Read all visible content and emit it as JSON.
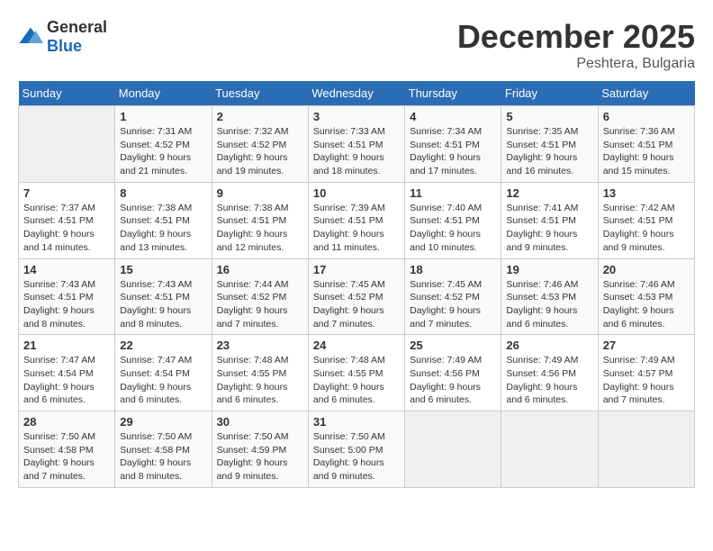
{
  "logo": {
    "general": "General",
    "blue": "Blue"
  },
  "title": "December 2025",
  "location": "Peshtera, Bulgaria",
  "days_of_week": [
    "Sunday",
    "Monday",
    "Tuesday",
    "Wednesday",
    "Thursday",
    "Friday",
    "Saturday"
  ],
  "weeks": [
    [
      {
        "day": "",
        "sunrise": "",
        "sunset": "",
        "daylight": "",
        "empty": true
      },
      {
        "day": "1",
        "sunrise": "Sunrise: 7:31 AM",
        "sunset": "Sunset: 4:52 PM",
        "daylight": "Daylight: 9 hours and 21 minutes."
      },
      {
        "day": "2",
        "sunrise": "Sunrise: 7:32 AM",
        "sunset": "Sunset: 4:52 PM",
        "daylight": "Daylight: 9 hours and 19 minutes."
      },
      {
        "day": "3",
        "sunrise": "Sunrise: 7:33 AM",
        "sunset": "Sunset: 4:51 PM",
        "daylight": "Daylight: 9 hours and 18 minutes."
      },
      {
        "day": "4",
        "sunrise": "Sunrise: 7:34 AM",
        "sunset": "Sunset: 4:51 PM",
        "daylight": "Daylight: 9 hours and 17 minutes."
      },
      {
        "day": "5",
        "sunrise": "Sunrise: 7:35 AM",
        "sunset": "Sunset: 4:51 PM",
        "daylight": "Daylight: 9 hours and 16 minutes."
      },
      {
        "day": "6",
        "sunrise": "Sunrise: 7:36 AM",
        "sunset": "Sunset: 4:51 PM",
        "daylight": "Daylight: 9 hours and 15 minutes."
      }
    ],
    [
      {
        "day": "7",
        "sunrise": "Sunrise: 7:37 AM",
        "sunset": "Sunset: 4:51 PM",
        "daylight": "Daylight: 9 hours and 14 minutes."
      },
      {
        "day": "8",
        "sunrise": "Sunrise: 7:38 AM",
        "sunset": "Sunset: 4:51 PM",
        "daylight": "Daylight: 9 hours and 13 minutes."
      },
      {
        "day": "9",
        "sunrise": "Sunrise: 7:38 AM",
        "sunset": "Sunset: 4:51 PM",
        "daylight": "Daylight: 9 hours and 12 minutes."
      },
      {
        "day": "10",
        "sunrise": "Sunrise: 7:39 AM",
        "sunset": "Sunset: 4:51 PM",
        "daylight": "Daylight: 9 hours and 11 minutes."
      },
      {
        "day": "11",
        "sunrise": "Sunrise: 7:40 AM",
        "sunset": "Sunset: 4:51 PM",
        "daylight": "Daylight: 9 hours and 10 minutes."
      },
      {
        "day": "12",
        "sunrise": "Sunrise: 7:41 AM",
        "sunset": "Sunset: 4:51 PM",
        "daylight": "Daylight: 9 hours and 9 minutes."
      },
      {
        "day": "13",
        "sunrise": "Sunrise: 7:42 AM",
        "sunset": "Sunset: 4:51 PM",
        "daylight": "Daylight: 9 hours and 9 minutes."
      }
    ],
    [
      {
        "day": "14",
        "sunrise": "Sunrise: 7:43 AM",
        "sunset": "Sunset: 4:51 PM",
        "daylight": "Daylight: 9 hours and 8 minutes."
      },
      {
        "day": "15",
        "sunrise": "Sunrise: 7:43 AM",
        "sunset": "Sunset: 4:51 PM",
        "daylight": "Daylight: 9 hours and 8 minutes."
      },
      {
        "day": "16",
        "sunrise": "Sunrise: 7:44 AM",
        "sunset": "Sunset: 4:52 PM",
        "daylight": "Daylight: 9 hours and 7 minutes."
      },
      {
        "day": "17",
        "sunrise": "Sunrise: 7:45 AM",
        "sunset": "Sunset: 4:52 PM",
        "daylight": "Daylight: 9 hours and 7 minutes."
      },
      {
        "day": "18",
        "sunrise": "Sunrise: 7:45 AM",
        "sunset": "Sunset: 4:52 PM",
        "daylight": "Daylight: 9 hours and 7 minutes."
      },
      {
        "day": "19",
        "sunrise": "Sunrise: 7:46 AM",
        "sunset": "Sunset: 4:53 PM",
        "daylight": "Daylight: 9 hours and 6 minutes."
      },
      {
        "day": "20",
        "sunrise": "Sunrise: 7:46 AM",
        "sunset": "Sunset: 4:53 PM",
        "daylight": "Daylight: 9 hours and 6 minutes."
      }
    ],
    [
      {
        "day": "21",
        "sunrise": "Sunrise: 7:47 AM",
        "sunset": "Sunset: 4:54 PM",
        "daylight": "Daylight: 9 hours and 6 minutes."
      },
      {
        "day": "22",
        "sunrise": "Sunrise: 7:47 AM",
        "sunset": "Sunset: 4:54 PM",
        "daylight": "Daylight: 9 hours and 6 minutes."
      },
      {
        "day": "23",
        "sunrise": "Sunrise: 7:48 AM",
        "sunset": "Sunset: 4:55 PM",
        "daylight": "Daylight: 9 hours and 6 minutes."
      },
      {
        "day": "24",
        "sunrise": "Sunrise: 7:48 AM",
        "sunset": "Sunset: 4:55 PM",
        "daylight": "Daylight: 9 hours and 6 minutes."
      },
      {
        "day": "25",
        "sunrise": "Sunrise: 7:49 AM",
        "sunset": "Sunset: 4:56 PM",
        "daylight": "Daylight: 9 hours and 6 minutes."
      },
      {
        "day": "26",
        "sunrise": "Sunrise: 7:49 AM",
        "sunset": "Sunset: 4:56 PM",
        "daylight": "Daylight: 9 hours and 6 minutes."
      },
      {
        "day": "27",
        "sunrise": "Sunrise: 7:49 AM",
        "sunset": "Sunset: 4:57 PM",
        "daylight": "Daylight: 9 hours and 7 minutes."
      }
    ],
    [
      {
        "day": "28",
        "sunrise": "Sunrise: 7:50 AM",
        "sunset": "Sunset: 4:58 PM",
        "daylight": "Daylight: 9 hours and 7 minutes."
      },
      {
        "day": "29",
        "sunrise": "Sunrise: 7:50 AM",
        "sunset": "Sunset: 4:58 PM",
        "daylight": "Daylight: 9 hours and 8 minutes."
      },
      {
        "day": "30",
        "sunrise": "Sunrise: 7:50 AM",
        "sunset": "Sunset: 4:59 PM",
        "daylight": "Daylight: 9 hours and 9 minutes."
      },
      {
        "day": "31",
        "sunrise": "Sunrise: 7:50 AM",
        "sunset": "Sunset: 5:00 PM",
        "daylight": "Daylight: 9 hours and 9 minutes."
      },
      {
        "day": "",
        "sunrise": "",
        "sunset": "",
        "daylight": "",
        "empty": true
      },
      {
        "day": "",
        "sunrise": "",
        "sunset": "",
        "daylight": "",
        "empty": true
      },
      {
        "day": "",
        "sunrise": "",
        "sunset": "",
        "daylight": "",
        "empty": true
      }
    ]
  ]
}
